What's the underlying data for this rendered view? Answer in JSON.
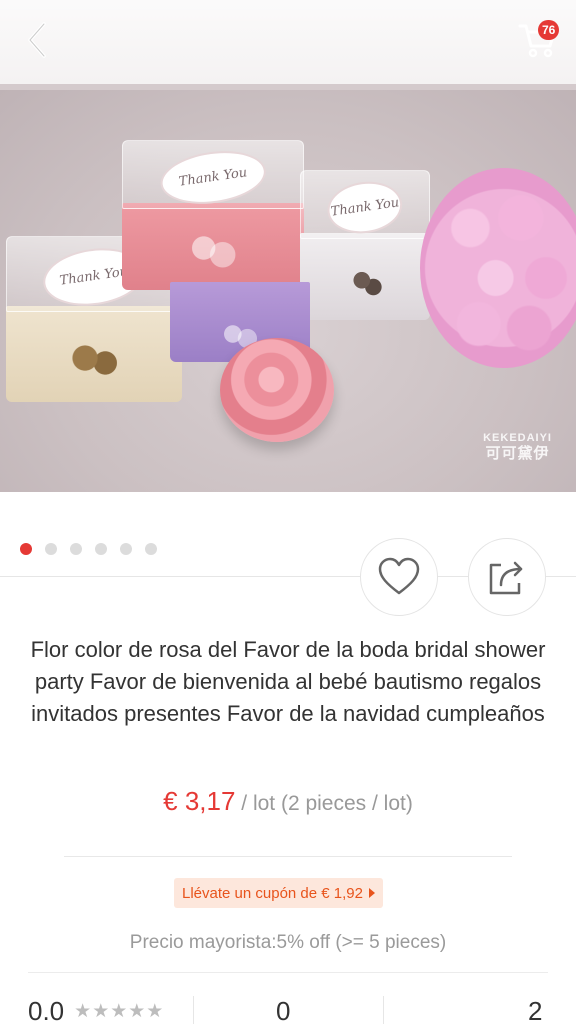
{
  "header": {
    "back_icon": "chevron-left-icon",
    "cart_icon": "shopping-cart-icon",
    "cart_count": "76"
  },
  "gallery": {
    "image_name": "wedding-favor-rose-soap-boxes",
    "watermark_line1": "KEKEDAIYI",
    "watermark_line2": "可可黛伊",
    "tag_text": "Thank You",
    "dots_total": 6,
    "active_dot": 0
  },
  "actions": {
    "wishlist_icon": "heart-outline-icon",
    "share_icon": "share-icon"
  },
  "product": {
    "title": "Flor color de rosa del Favor de la boda bridal shower party Favor de bienvenida al bebé bautismo regalos invitados presentes Favor de la navidad cumpleaños",
    "price": "€ 3,17",
    "price_unit": " / lot (2 pieces / lot)",
    "coupon": "Llévate un cupón de € 1,92",
    "wholesale": "Precio mayorista:5% off (>= 5 pieces)"
  },
  "stats": {
    "rating": "0.0",
    "stars": "★★★★★",
    "mid_value": "0",
    "right_value": "2"
  },
  "colors": {
    "accent": "#e53935",
    "coupon_bg": "#fde7dc",
    "coupon_text": "#e8541c"
  }
}
